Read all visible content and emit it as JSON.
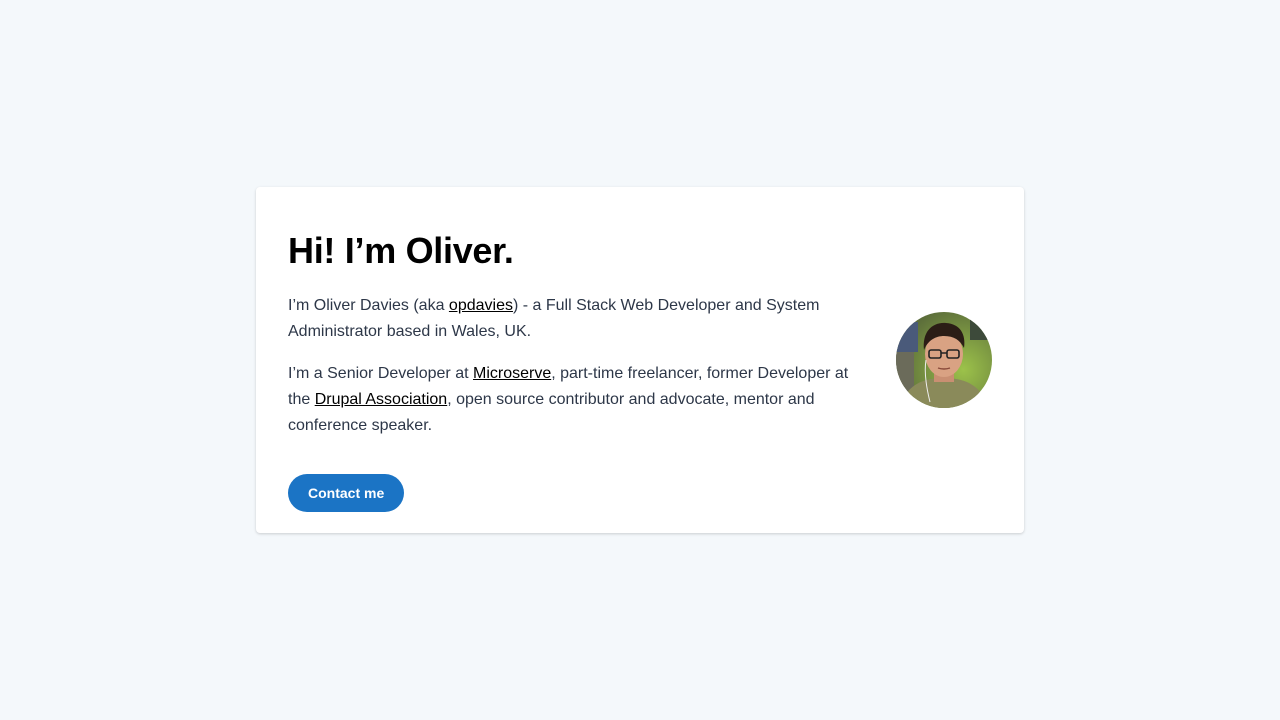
{
  "hero": {
    "title": "Hi! I’m Oliver.",
    "intro": {
      "before_link": "I’m Oliver Davies (aka ",
      "link": "opdavies",
      "after_link": ") - a Full Stack Web Developer and System Administrator based in Wales, UK."
    },
    "bio": {
      "part1": "I’m a Senior Developer at ",
      "link1": "Microserve",
      "part2": ", part-time freelancer, former Developer at the ",
      "link2": "Drupal Association",
      "part3": ", open source contributor and advocate, mentor and conference speaker."
    },
    "contact_label": "Contact me",
    "avatar_alt": "Oliver Davies"
  },
  "colors": {
    "background": "#f4f8fb",
    "card": "#ffffff",
    "button": "#1b74c5",
    "text": "#2d3748"
  }
}
